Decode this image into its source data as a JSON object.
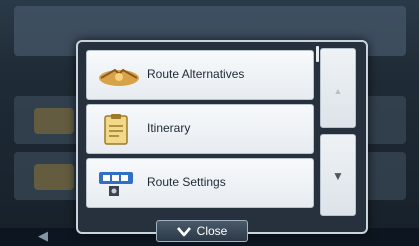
{
  "popup": {
    "items": [
      {
        "label": "Route Alternatives",
        "icon": "route-alternatives-icon"
      },
      {
        "label": "Itinerary",
        "icon": "itinerary-icon"
      },
      {
        "label": "Route Settings",
        "icon": "route-settings-icon"
      }
    ],
    "close_label": "Close",
    "scroll_up_glyph": "▲",
    "scroll_down_glyph": "▼"
  },
  "colors": {
    "popup_background": "#26313d",
    "item_background": "#f0f3f6",
    "popup_border": "#c9d4de"
  }
}
